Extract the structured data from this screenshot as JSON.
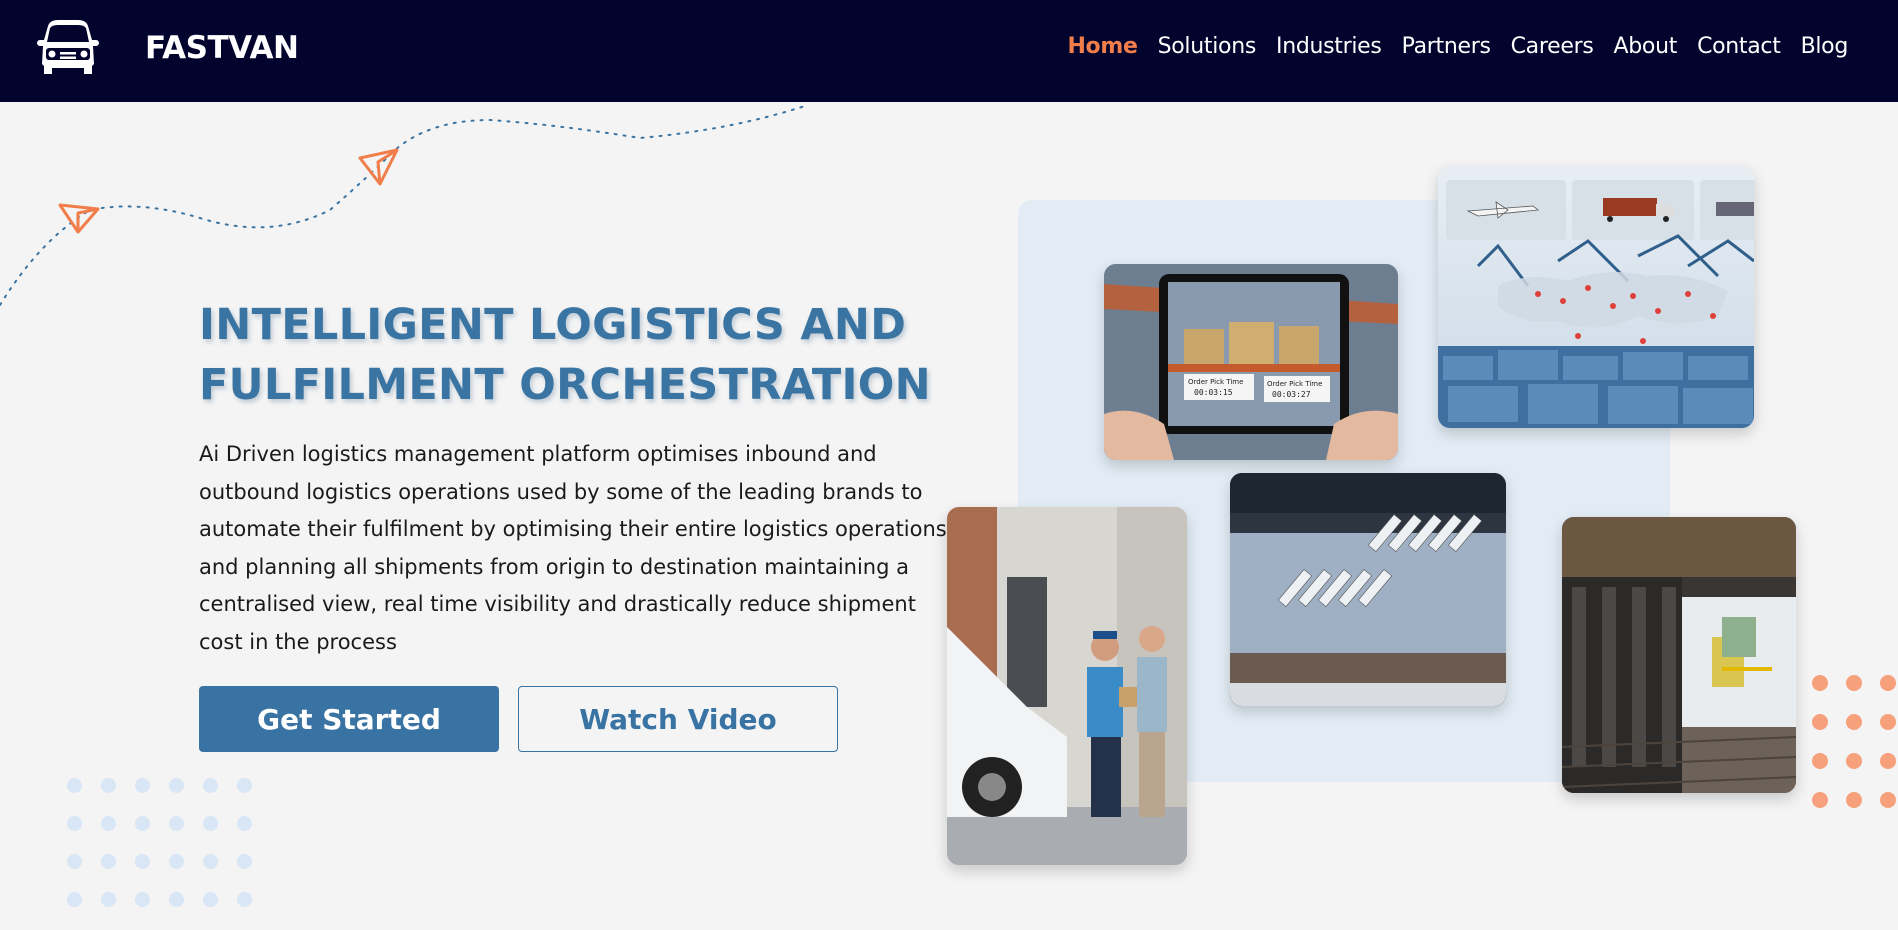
{
  "header": {
    "brand": "FASTVAN",
    "logo_icon": "van-icon",
    "nav": [
      {
        "label": "Home",
        "active": true
      },
      {
        "label": "Solutions",
        "active": false
      },
      {
        "label": "Industries",
        "active": false
      },
      {
        "label": "Partners",
        "active": false
      },
      {
        "label": "Careers",
        "active": false
      },
      {
        "label": "About",
        "active": false
      },
      {
        "label": "Contact",
        "active": false
      },
      {
        "label": "Blog",
        "active": false
      }
    ]
  },
  "hero": {
    "title_line1": "INTELLIGENT LOGISTICS AND",
    "title_line2": "FULFILMENT ORCHESTRATION",
    "description": "Ai Driven logistics management platform optimises inbound and outbound logistics operations used by some of the leading brands to automate their fulfilment by optimising their entire logistics operations and planning all shipments from origin to destination maintaining a centralised view, real time visibility and drastically reduce shipment cost in the process",
    "primary_button": "Get Started",
    "secondary_button": "Watch Video"
  },
  "images": {
    "tablet_labels": [
      "Order Pick Time",
      "00:03:15",
      "Order Pick Time",
      "00:03:27"
    ]
  },
  "colors": {
    "header_bg": "#03042e",
    "accent": "#f07d4a",
    "primary": "#3873a3",
    "page_bg": "#f4f4f4"
  },
  "decor": {
    "icons": [
      "paper-plane-icon",
      "paper-plane-icon"
    ]
  }
}
